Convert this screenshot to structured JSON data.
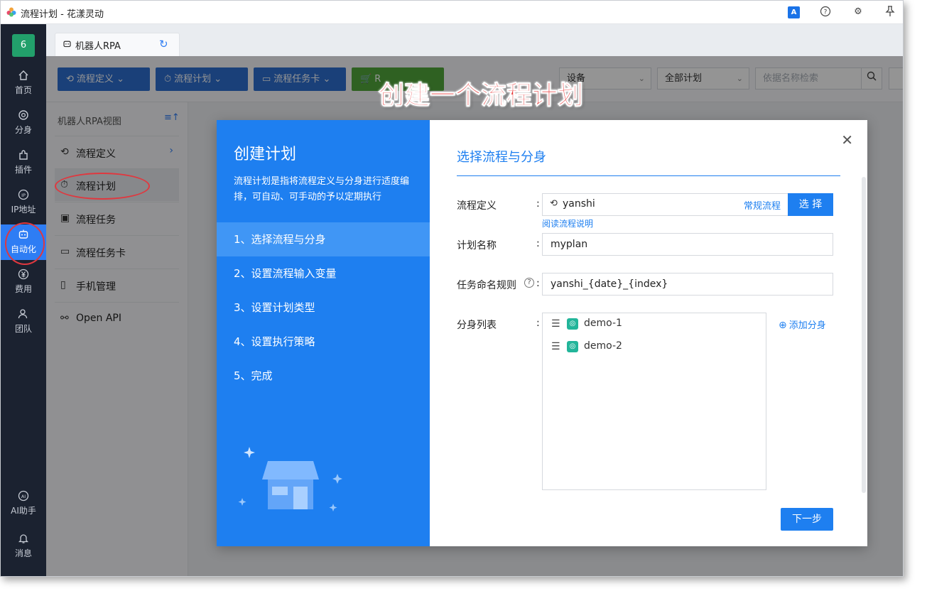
{
  "window": {
    "title": "流程计划 - 花漾灵动"
  },
  "leftnav": {
    "avatar": "6",
    "items": [
      {
        "label": "首页",
        "icon": "home-icon"
      },
      {
        "label": "分身",
        "icon": "browser-icon"
      },
      {
        "label": "插件",
        "icon": "puzzle-icon"
      },
      {
        "label": "IP地址",
        "icon": "ip-icon"
      },
      {
        "label": "自动化",
        "icon": "robot-icon"
      },
      {
        "label": "费用",
        "icon": "yen-icon"
      },
      {
        "label": "团队",
        "icon": "team-icon"
      }
    ],
    "bottom": [
      {
        "label": "AI助手",
        "icon": "ai-icon"
      },
      {
        "label": "消息",
        "icon": "bell-icon"
      }
    ]
  },
  "tab": {
    "label": "机器人RPA"
  },
  "toolbar": {
    "btn1": "流程定义",
    "btn2": "流程计划",
    "btn3": "流程任务卡",
    "btn4": "R",
    "select1": "设备",
    "select2": "全部计划",
    "search_placeholder": "依据名称检索"
  },
  "sidepanel": {
    "title": "机器人RPA视图",
    "items": [
      {
        "label": "流程定义"
      },
      {
        "label": "流程计划"
      },
      {
        "label": "流程任务"
      },
      {
        "label": "流程任务卡"
      },
      {
        "label": "手机管理"
      },
      {
        "label": "Open API"
      }
    ]
  },
  "modal": {
    "left_title": "创建计划",
    "left_desc": "流程计划是指将流程定义与分身进行适度编排，可自动、可手动的予以定期执行",
    "steps": [
      "1、选择流程与分身",
      "2、设置流程输入变量",
      "3、设置计划类型",
      "4、设置执行策略",
      "5、完成"
    ],
    "right_title": "选择流程与分身",
    "flow_label": "流程定义",
    "flow_value": "yanshi",
    "flow_type": "常规流程",
    "select_btn": "选 择",
    "read_link": "阅读流程说明",
    "plan_label": "计划名称",
    "plan_value": "myplan",
    "naming_label": "任务命名规则",
    "naming_value": "yanshi_{date}_{index}",
    "list_label": "分身列表",
    "colon": ":",
    "list_items": [
      "demo-1",
      "demo-2"
    ],
    "add_link": "添加分身",
    "next_btn": "下一步"
  },
  "annotation": "创建一个流程计划",
  "colors": {
    "primary": "#1e7ff0",
    "nav_bg": "#1b2230",
    "annotation_red": "#e83a3a",
    "toolbar_blue": "#2e6fd1"
  }
}
